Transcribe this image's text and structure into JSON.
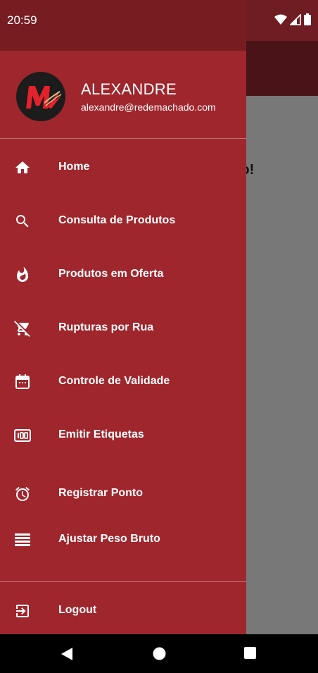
{
  "status_bar": {
    "time": "20:59"
  },
  "background": {
    "partial_text": "ndo!"
  },
  "drawer": {
    "user": {
      "name": "ALEXANDRE",
      "email": "alexandre@redemachado.com"
    },
    "menu": [
      {
        "label": "Home",
        "icon": "home-icon"
      },
      {
        "label": "Consulta de Produtos",
        "icon": "search-icon"
      },
      {
        "label": "Produtos em Oferta",
        "icon": "fire-icon"
      },
      {
        "label": "Rupturas por Rua",
        "icon": "cart-off-icon"
      },
      {
        "label": "Controle de Validade",
        "icon": "calendar-icon"
      },
      {
        "label": "Emitir Etiquetas",
        "icon": "label-100-icon"
      },
      {
        "label": "Registrar Ponto",
        "icon": "alarm-icon"
      },
      {
        "label": "Ajustar Peso Bruto",
        "icon": "list-icon"
      }
    ],
    "logout": {
      "label": "Logout",
      "icon": "logout-icon"
    }
  },
  "colors": {
    "drawer": "#9e262c",
    "drawer_status": "#771d22",
    "scrim": "#787878"
  }
}
